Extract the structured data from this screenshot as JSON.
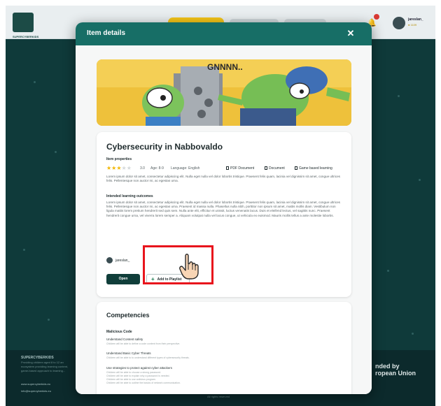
{
  "background": {
    "user_name": "jareslan_",
    "coins": "● 1109",
    "footer_title": "SUPERCYBERKIDS",
    "footer_desc": "Providing children aged 8 to 12 an ecosystem providing learning content, game-based approach to learning...",
    "footer_link_1": "www.supercyberkids.eu",
    "footer_link_2": "info@supercyberkids.eu",
    "eu_text": "nded by\nropean Union",
    "copyright": "All rights reserved"
  },
  "modal": {
    "title": "Item details",
    "close_glyph": "✕"
  },
  "item": {
    "title": "Cybersecurity in Nabbovaldo",
    "properties_label": "Item properties",
    "rating": 3,
    "rating_max": 5,
    "rating_text": "3.0",
    "age": "Age: 8-9",
    "language": "Language: English",
    "tags": [
      "PDF Document",
      "Document",
      "Game based learning"
    ],
    "description": "Lorem ipsum dolor sit amet, consectetur adipiscing elit. Nulla eget nulla vel dolor lobortis tristique. Praesent felis quam, lacinia vel dignissim sit amet, congue ultrices felis. Pellentesque non auctor mi, ac egestas urna.",
    "outcomes_label": "Intended learning outcomes",
    "outcomes_text": "Lorem ipsum dolor sit amet, consectetur adipiscing elit. Nulla eget nulla vel dolor lobortis tristique. Praesent felis quam, lacinia vel dignissim sit amet, congue ultrices felis. Pellentesque non auctor mi, ac egestas urna. Praesent id massa nulla. Phasellus nulla nibh, porttitor non ipsum sit amet, mattis mollis diam. Vestibulum non ligula mattis lorem pretium hendrerit sed quis sem. Nulla ante elit, efficitur et unissit, luctus venenatis lacus. Duis et eleifend lectus, vel sagittis nunc. Praesent hendrerit congue urna, vel viverra lorem semper a. Aliquam volutpat nulla vel lacus congue, ut vehicula ex euismod. Mauris mollis tellus a ante molestie lobortis.",
    "author": "jareslan_",
    "open_label": "Open",
    "playlist_label": "Add to Playlist",
    "hero_text": "GNNNN.."
  },
  "competencies": {
    "title": "Competencies",
    "group": "Malicious Code",
    "items": [
      {
        "label": "Understand Content safety",
        "sub": [
          "Children will be able to define a code content from their perspective."
        ]
      },
      {
        "label": "Understand Basic Cyber Threats",
        "sub": [
          "Children will be able to to understand different types of cybersecurity threats."
        ]
      },
      {
        "label": "Use strategies to protect against cyber attackers",
        "sub": [
          "Children will be able to choose a strong password.",
          "Children will be able to explain why a password is needed.",
          "Children will be able to use antivirus program.",
          "Children will be able to outline the basics of network communication."
        ]
      }
    ]
  }
}
